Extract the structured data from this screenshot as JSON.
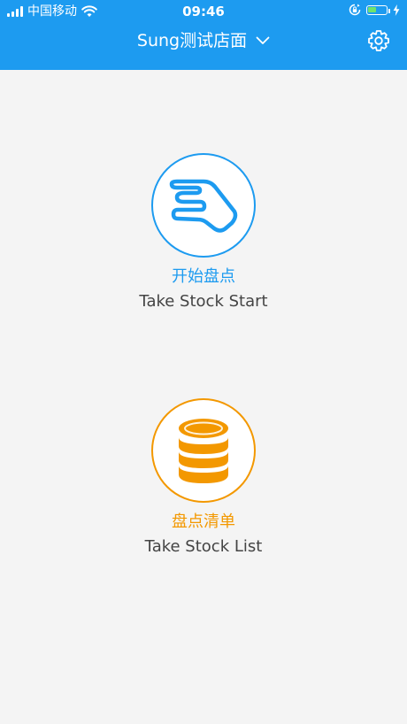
{
  "status_bar": {
    "carrier": "中国移动",
    "time": "09:46",
    "battery_fill_percent": 50,
    "icons": [
      "signal-bars-icon",
      "wifi-icon",
      "rotation-lock-icon",
      "battery-icon",
      "charging-icon"
    ]
  },
  "navbar": {
    "store_name": "Sung测试店面",
    "dropdown_icon": "chevron-down-icon",
    "settings_icon": "gear-icon"
  },
  "actions": {
    "start": {
      "title_cn": "开始盘点",
      "title_en": "Take Stock Start",
      "icon": "hand-pinch-icon",
      "color": "#1d9bf0"
    },
    "list": {
      "title_cn": "盘点清单",
      "title_en": "Take Stock List",
      "icon": "coin-stack-icon",
      "color": "#f39800"
    }
  },
  "colors": {
    "header_bg": "#1d9bf0",
    "page_bg": "#f4f4f4",
    "accent_blue": "#1d9bf0",
    "accent_orange": "#f39800"
  }
}
